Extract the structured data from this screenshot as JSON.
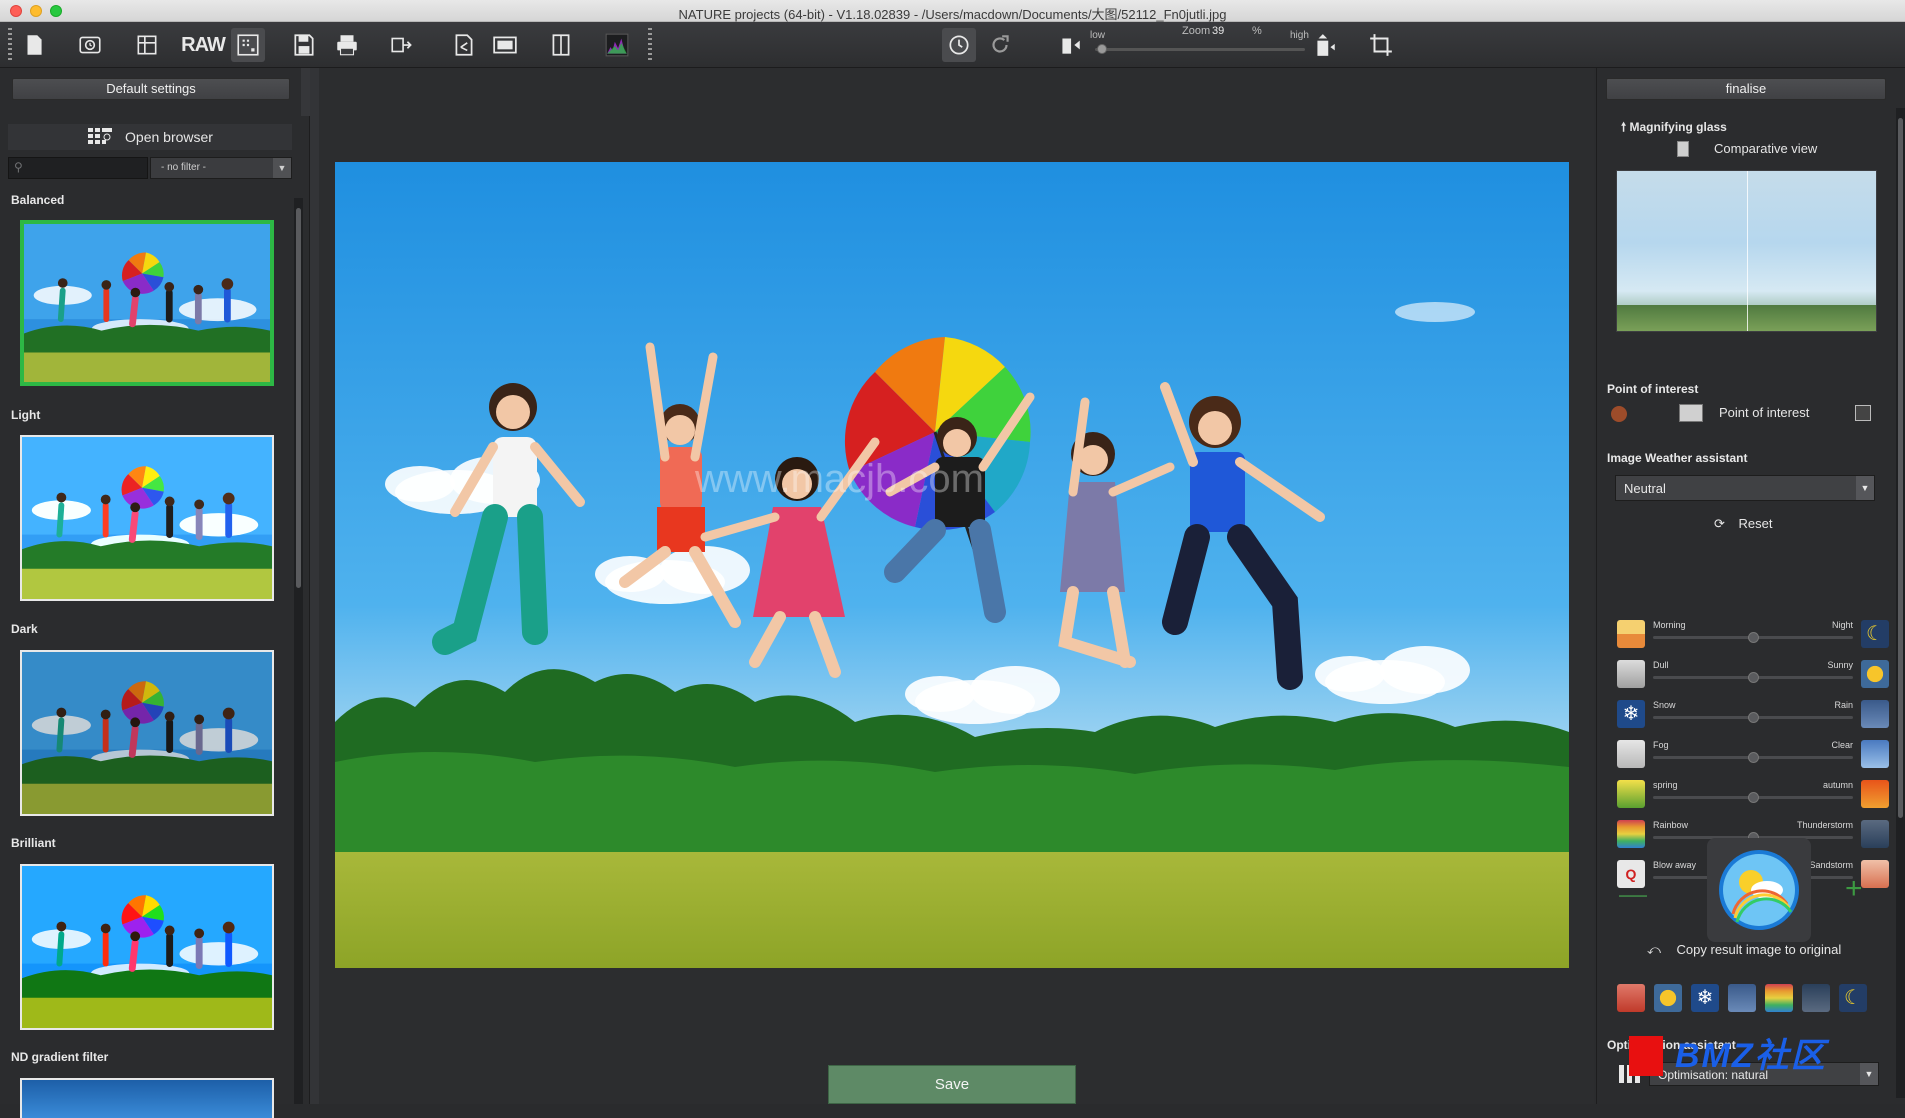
{
  "window": {
    "title": "NATURE projects (64-bit) - V1.18.02839 - /Users/macdown/Documents/大图/52112_Fn0jutli.jpg"
  },
  "toolbar": {
    "raw_label": "RAW",
    "zoom_label": "Zoom",
    "zoom_value": "39",
    "zoom_unit": "%",
    "low_label": "low",
    "high_label": "high"
  },
  "left_panel": {
    "default_settings": "Default settings",
    "open_browser": "Open browser",
    "filter_value": "- no filter -",
    "presets": [
      {
        "label": "Balanced",
        "selected": true
      },
      {
        "label": "Light",
        "selected": false
      },
      {
        "label": "Dark",
        "selected": false
      },
      {
        "label": "Brilliant",
        "selected": false
      },
      {
        "label": "ND gradient filter",
        "selected": false
      }
    ]
  },
  "center": {
    "watermark": "www.macjb.com",
    "save_label": "Save"
  },
  "right_panel": {
    "finalise": "finalise",
    "magnifying_glass": "Magnifying glass",
    "comparative_view": "Comparative view",
    "poi_section": "Point of interest",
    "poi_label": "Point of interest",
    "weather_section": "Image Weather assistant",
    "weather_preset": "Neutral",
    "reset_label": "Reset",
    "sliders": [
      {
        "left": "Morning",
        "right": "Night",
        "value": 0.5,
        "left_icon": "sunrise-icon",
        "right_icon": "moon-icon"
      },
      {
        "left": "Dull",
        "right": "Sunny",
        "value": 0.5,
        "left_icon": "bare-tree-icon",
        "right_icon": "sun-icon"
      },
      {
        "left": "Snow",
        "right": "Rain",
        "value": 0.5,
        "left_icon": "snowflake-icon",
        "right_icon": "rain-cloud-icon"
      },
      {
        "left": "Fog",
        "right": "Clear",
        "value": 0.5,
        "left_icon": "fog-icon",
        "right_icon": "clear-sky-icon"
      },
      {
        "left": "spring",
        "right": "autumn",
        "value": 0.5,
        "left_icon": "tulip-icon",
        "right_icon": "autumn-leaf-icon"
      },
      {
        "left": "Rainbow",
        "right": "Thunderstorm",
        "value": 0.5,
        "left_icon": "rainbow-icon",
        "right_icon": "thunderstorm-icon"
      },
      {
        "left": "Blow away",
        "right": "Sandstorm",
        "value": 0.5,
        "left_icon": "blow-away-icon",
        "right_icon": "sandstorm-icon"
      }
    ],
    "copy_result": "Copy result image to original",
    "optimisation_section": "Optimisation assistant",
    "optimisation_value": "Optimisation: natural",
    "site_watermark": "BMZ社区"
  },
  "colors": {
    "accent_green": "#2db845",
    "save_green": "#5e8a66",
    "panel_bg": "#2b2c2e"
  }
}
